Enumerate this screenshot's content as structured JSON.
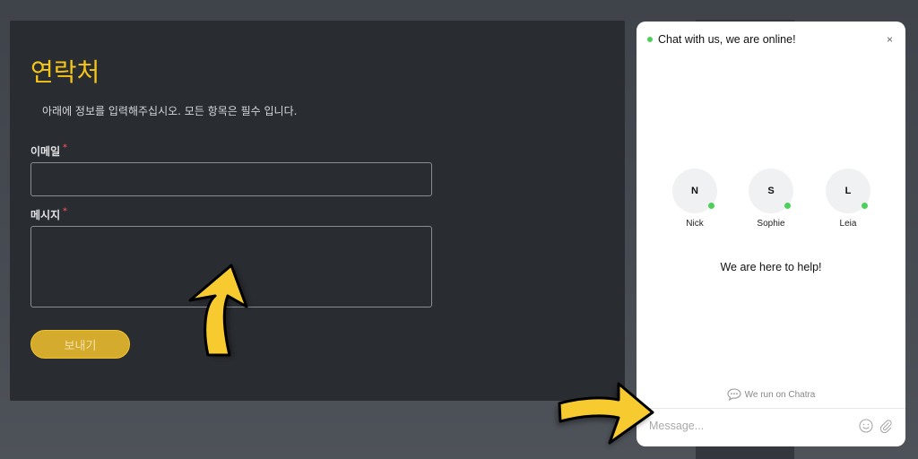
{
  "form": {
    "title": "연락처",
    "description": "아래에 정보를 입력해주십시오. 모든 항목은 필수 입니다.",
    "email_label": "이메일",
    "message_label": "메시지",
    "required_mark": "*",
    "email_value": "",
    "message_value": "",
    "send_label": "보내기"
  },
  "chat": {
    "header": "Chat with us, we are online!",
    "close": "×",
    "agents": [
      {
        "initial": "N",
        "name": "Nick"
      },
      {
        "initial": "S",
        "name": "Sophie"
      },
      {
        "initial": "L",
        "name": "Leia"
      }
    ],
    "help_text": "We are here to help!",
    "powered_by": "We run on Chatra",
    "message_placeholder": "Message...",
    "online_color": "#4cd05a"
  },
  "colors": {
    "accent": "#f5c518",
    "card": "#292c31"
  }
}
